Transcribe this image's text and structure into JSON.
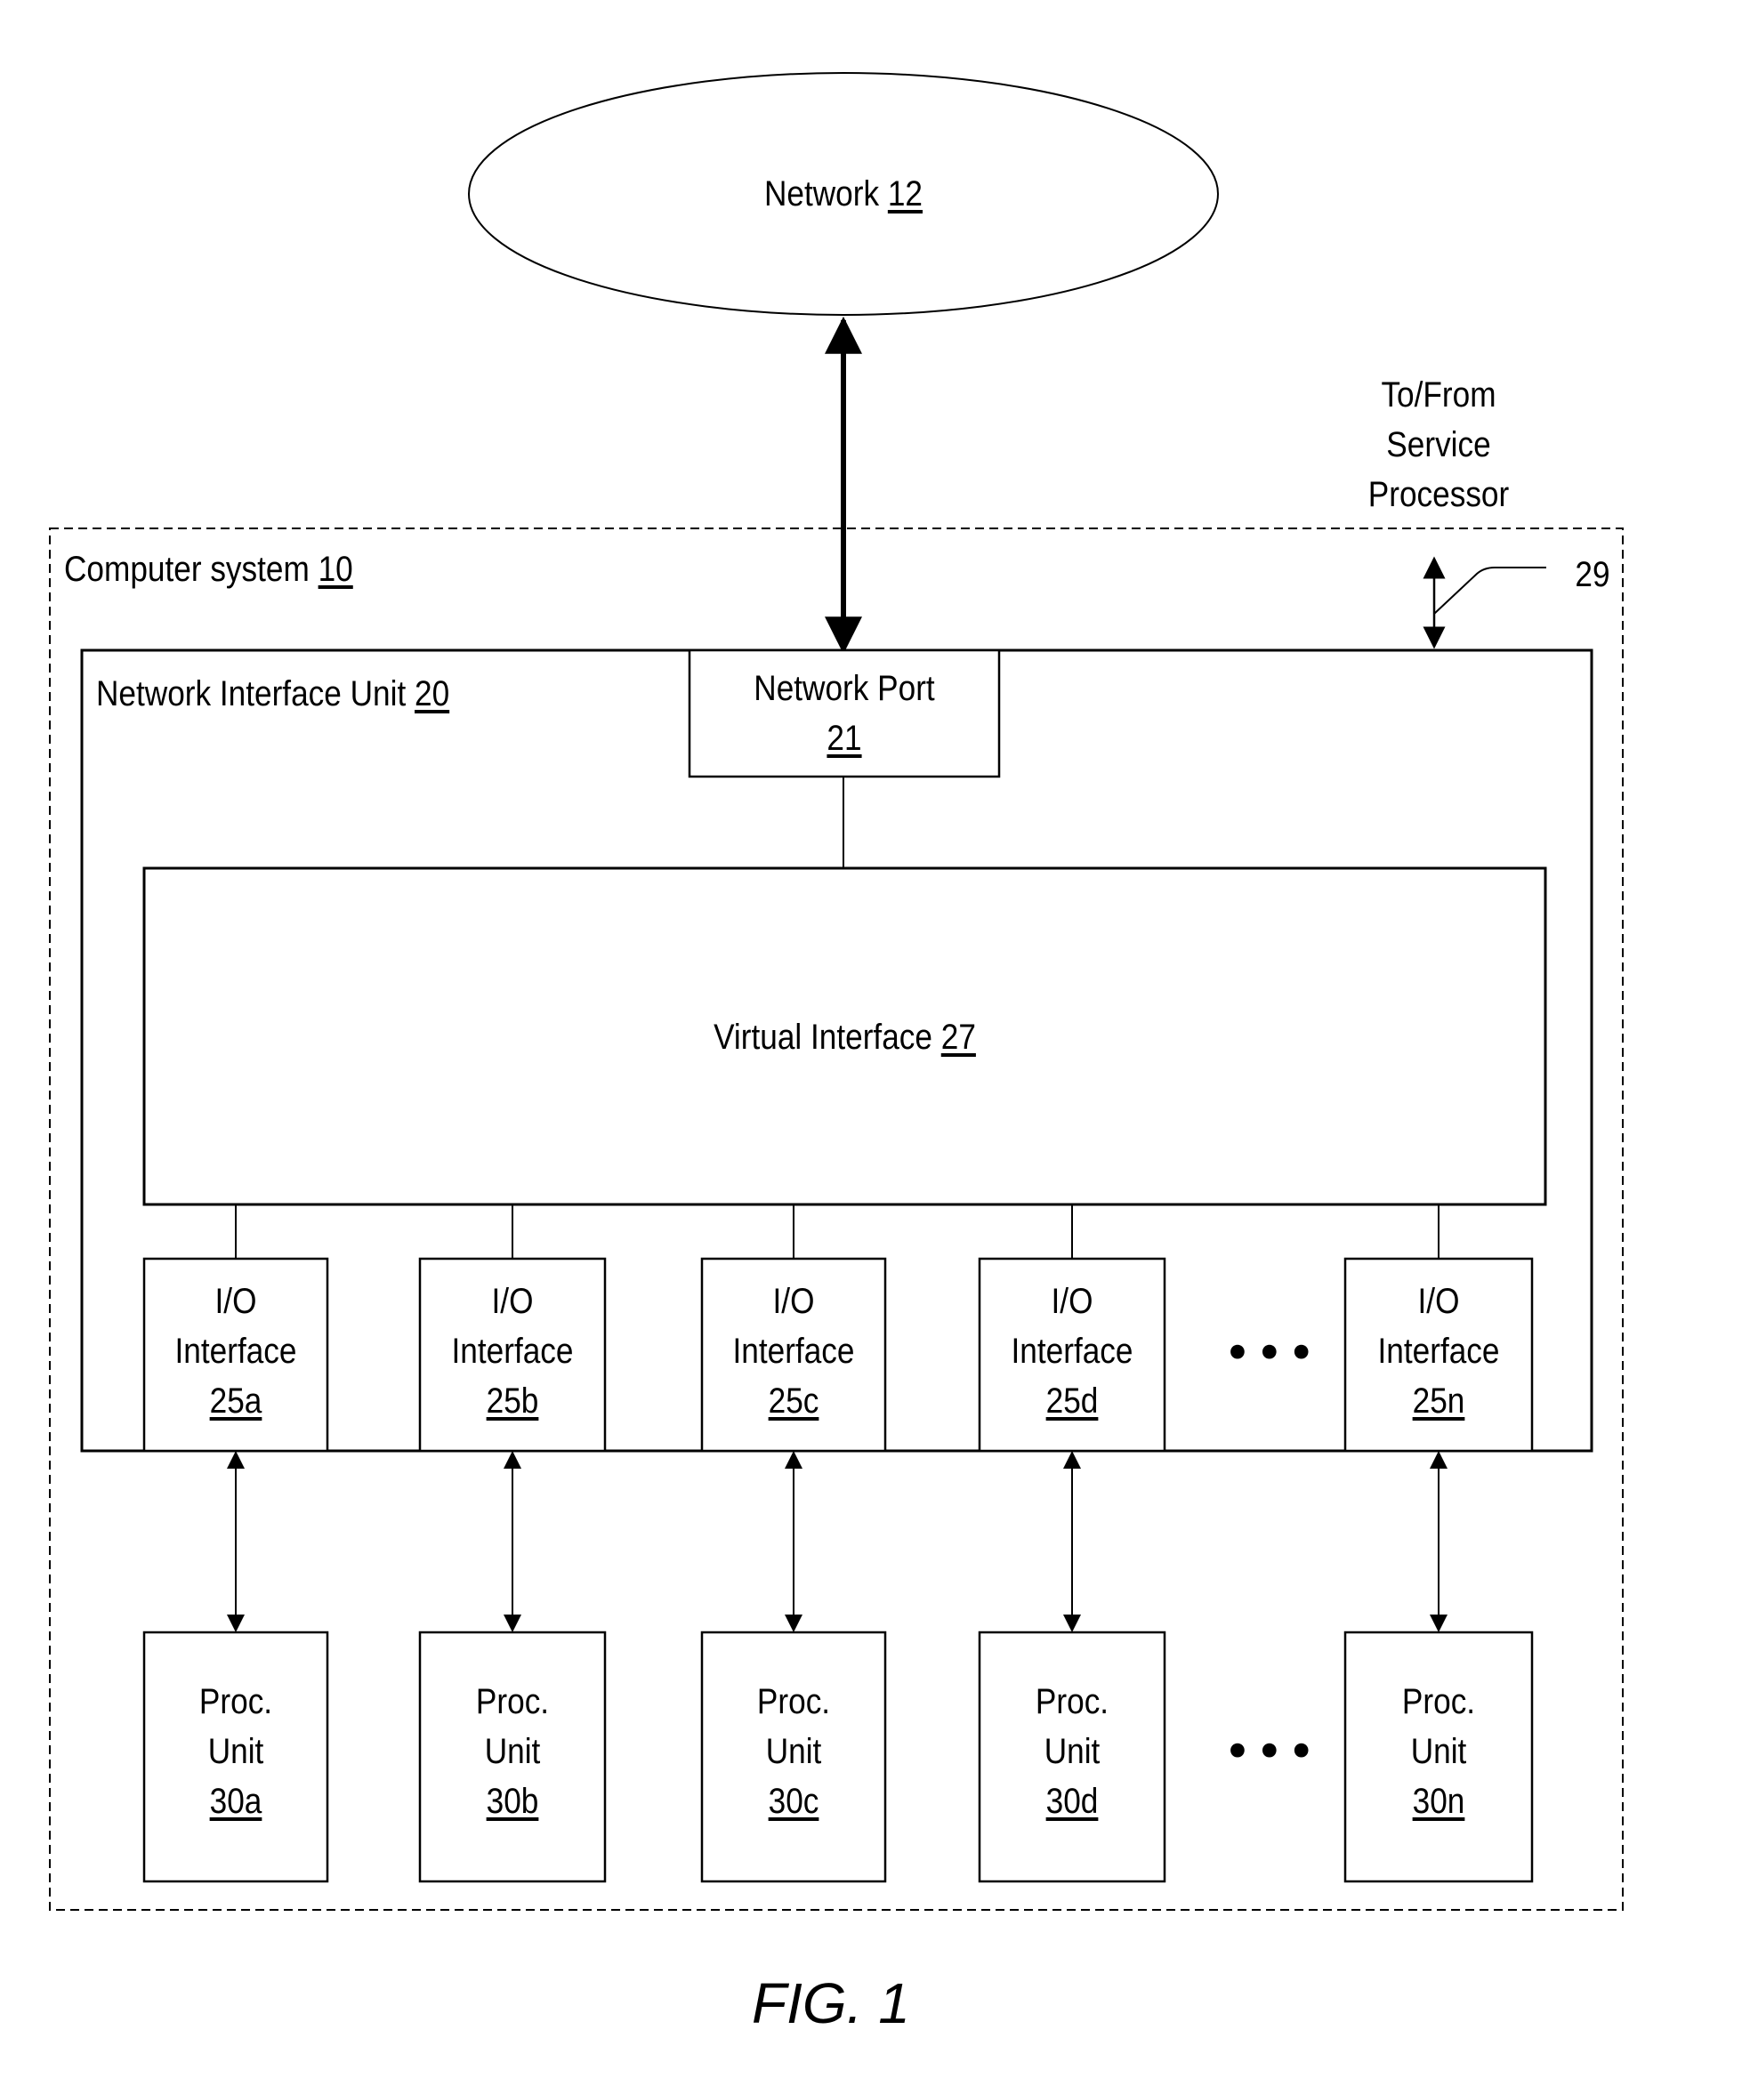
{
  "figure": {
    "caption": "FIG. 1"
  },
  "network": {
    "name": "Network",
    "ref": "12"
  },
  "service_processor": {
    "lines": [
      "To/From",
      "Service",
      "Processor"
    ],
    "ref": "29"
  },
  "computer_system": {
    "name": "Computer system",
    "ref": "10"
  },
  "network_interface_unit": {
    "name": "Network Interface Unit",
    "ref": "20"
  },
  "network_port": {
    "name": "Network Port",
    "ref": "21"
  },
  "virtual_interface": {
    "name": "Virtual Interface",
    "ref": "27"
  },
  "io_interfaces": [
    {
      "line1": "I/O",
      "line2": "Interface",
      "ref": "25a"
    },
    {
      "line1": "I/O",
      "line2": "Interface",
      "ref": "25b"
    },
    {
      "line1": "I/O",
      "line2": "Interface",
      "ref": "25c"
    },
    {
      "line1": "I/O",
      "line2": "Interface",
      "ref": "25d"
    },
    {
      "line1": "I/O",
      "line2": "Interface",
      "ref": "25n"
    }
  ],
  "proc_units": [
    {
      "line1": "Proc.",
      "line2": "Unit",
      "ref": "30a"
    },
    {
      "line1": "Proc.",
      "line2": "Unit",
      "ref": "30b"
    },
    {
      "line1": "Proc.",
      "line2": "Unit",
      "ref": "30c"
    },
    {
      "line1": "Proc.",
      "line2": "Unit",
      "ref": "30d"
    },
    {
      "line1": "Proc.",
      "line2": "Unit",
      "ref": "30n"
    }
  ],
  "ellipsis": "•••"
}
